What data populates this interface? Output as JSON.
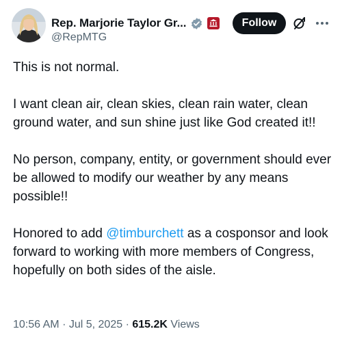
{
  "author": {
    "display_name": "Rep. Marjorie Taylor Gr...",
    "handle": "@RepMTG",
    "verified_icon": "verified-badge-icon",
    "affiliation_icon": "government-building-icon"
  },
  "actions": {
    "follow_label": "Follow",
    "grok_icon": "grok-icon",
    "more_icon": "more-options-icon"
  },
  "tweet": {
    "p1": "This is not normal.",
    "p2": "I want clean air, clean skies, clean rain water, clean ground water, and sun shine just like God created it!!",
    "p3": "No person, company, entity, or government should ever be allowed to modify our weather by any means possible!!",
    "p4_before": "Honored to add ",
    "p4_mention": "@timburchett",
    "p4_after": " as a cosponsor and look forward to working with more members of Congress, hopefully on both sides of the aisle."
  },
  "meta": {
    "time": "10:56 AM",
    "date": "Jul 5, 2025",
    "separator": "·",
    "views_count": "615.2K",
    "views_label": "Views"
  },
  "colors": {
    "text": "#0f1419",
    "secondary": "#536471",
    "link": "#1d9bf0",
    "button_bg": "#0f1419",
    "badge_red": "#b5192a"
  }
}
